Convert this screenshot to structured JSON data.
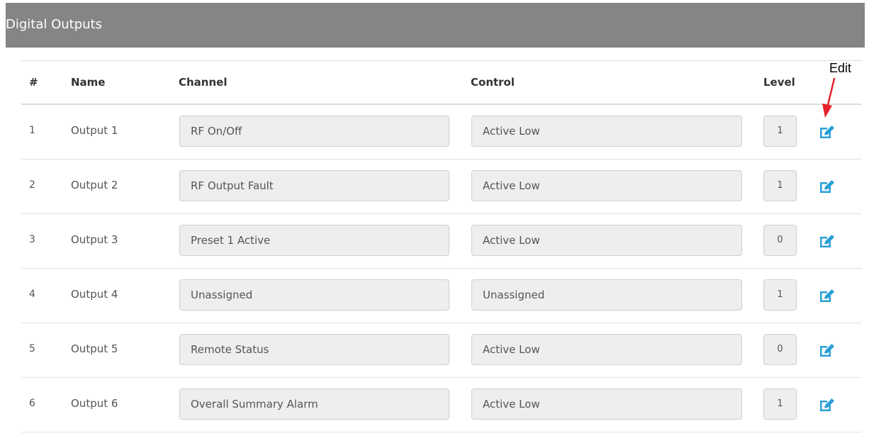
{
  "panel": {
    "title": "Digital Outputs"
  },
  "table": {
    "headers": {
      "number": "#",
      "name": "Name",
      "channel": "Channel",
      "control": "Control",
      "level": "Level"
    },
    "rows": [
      {
        "number": "1",
        "name": "Output 1",
        "channel": "RF On/Off",
        "control": "Active Low",
        "level": "1"
      },
      {
        "number": "2",
        "name": "Output 2",
        "channel": "RF Output Fault",
        "control": "Active Low",
        "level": "1"
      },
      {
        "number": "3",
        "name": "Output 3",
        "channel": "Preset 1 Active",
        "control": "Active Low",
        "level": "0"
      },
      {
        "number": "4",
        "name": "Output 4",
        "channel": "Unassigned",
        "control": "Unassigned",
        "level": "1"
      },
      {
        "number": "5",
        "name": "Output 5",
        "channel": "Remote Status",
        "control": "Active Low",
        "level": "0"
      },
      {
        "number": "6",
        "name": "Output 6",
        "channel": "Overall Summary Alarm",
        "control": "Active Low",
        "level": "1"
      }
    ]
  },
  "annotation": {
    "label": "Edit",
    "arrow_color": "#e8222a"
  },
  "icons": {
    "edit": "edit-icon"
  },
  "colors": {
    "header_bg": "#858585",
    "edit_icon": "#2a9fd6"
  }
}
